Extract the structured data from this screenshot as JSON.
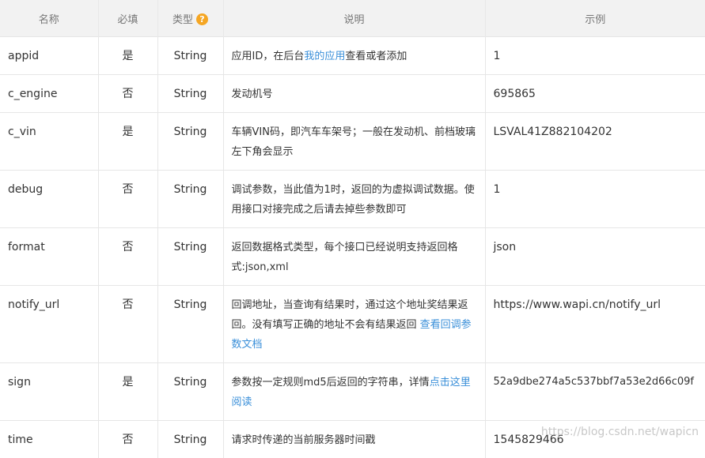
{
  "headers": {
    "name": "名称",
    "required": "必填",
    "type": "类型",
    "type_help_icon": "?",
    "description": "说明",
    "example": "示例"
  },
  "rows": [
    {
      "name": "appid",
      "required": "是",
      "type": "String",
      "desc_pre": "应用ID，在后台",
      "desc_link": "我的应用",
      "desc_post": "查看或者添加",
      "example": "1"
    },
    {
      "name": "c_engine",
      "required": "否",
      "type": "String",
      "desc_pre": "发动机号",
      "desc_link": "",
      "desc_post": "",
      "example": "695865"
    },
    {
      "name": "c_vin",
      "required": "是",
      "type": "String",
      "desc_pre": "车辆VIN码，即汽车车架号；一般在发动机、前档玻璃左下角会显示",
      "desc_link": "",
      "desc_post": "",
      "example": "LSVAL41Z882104202"
    },
    {
      "name": "debug",
      "required": "否",
      "type": "String",
      "desc_pre": "调试参数，当此值为1时，返回的为虚拟调试数据。使用接口对接完成之后请去掉些参数即可",
      "desc_link": "",
      "desc_post": "",
      "example": "1"
    },
    {
      "name": "format",
      "required": "否",
      "type": "String",
      "desc_pre": "返回数据格式类型，每个接口已经说明支持返回格式:json,xml",
      "desc_link": "",
      "desc_post": "",
      "example": "json"
    },
    {
      "name": "notify_url",
      "required": "否",
      "type": "String",
      "desc_pre": "回调地址，当查询有结果时，通过这个地址奖结果返回。没有填写正确的地址不会有结果返回 ",
      "desc_link": "查看回调参数文档",
      "desc_post": "",
      "example": "https://www.wapi.cn/notify_url"
    },
    {
      "name": "sign",
      "required": "是",
      "type": "String",
      "desc_pre": "参数按一定规则md5后返回的字符串，详情",
      "desc_link": "点击这里阅读",
      "desc_post": "",
      "example": "52a9dbe274a5c537bbf7a53e2d66c09f"
    },
    {
      "name": "time",
      "required": "否",
      "type": "String",
      "desc_pre": "请求时传递的当前服务器时间戳",
      "desc_link": "",
      "desc_post": "",
      "example": "1545829466"
    }
  ],
  "watermark": "https://blog.csdn.net/wapicn"
}
